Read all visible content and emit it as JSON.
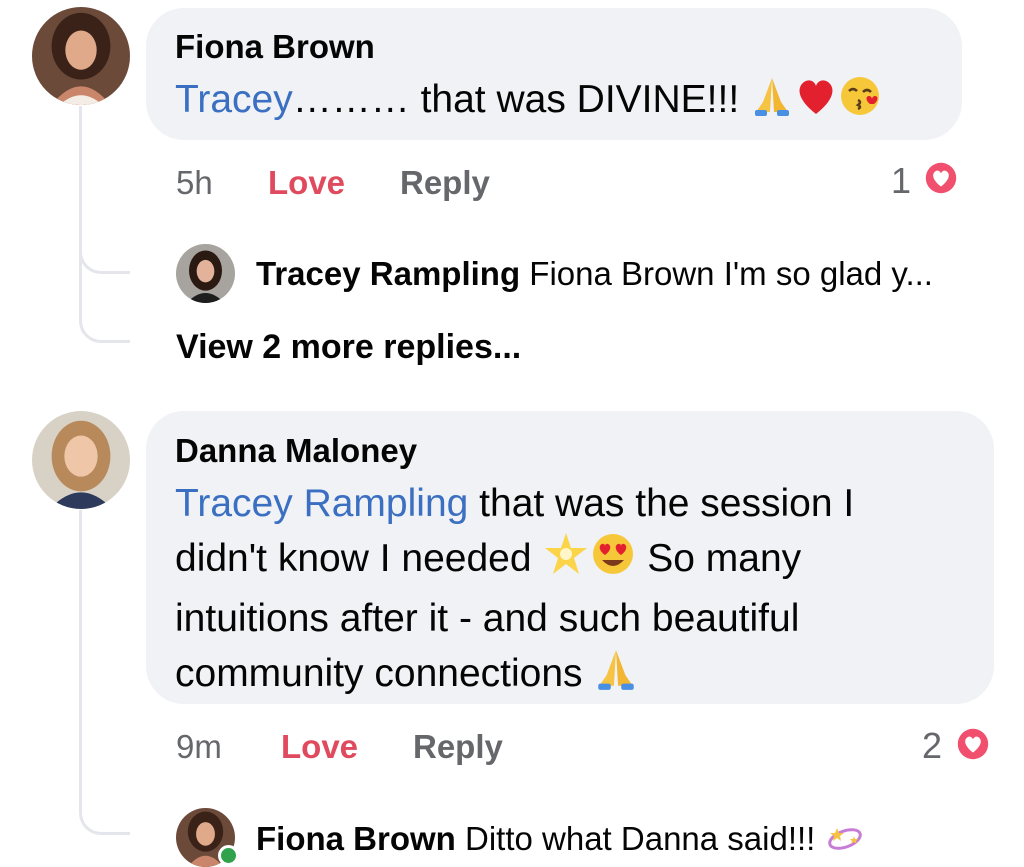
{
  "comments": [
    {
      "author": "Fiona Brown",
      "mention": "Tracey",
      "ellipsis": "………",
      "text": " that was DIVINE!!! ",
      "time": "5h",
      "love_label": "Love",
      "reply_label": "Reply",
      "reaction_count": "1",
      "emojis": [
        "folded-hands-emoji",
        "red-heart-emoji",
        "kissing-face-emoji"
      ],
      "reply": {
        "author": "Tracey Rampling",
        "text": "Fiona Brown I'm so glad y..."
      },
      "view_more": "View 2 more replies..."
    },
    {
      "author": "Danna Maloney",
      "mention": "Tracey Rampling",
      "line1_rest": " that was the session I",
      "line2_pre": "didn't know I needed ",
      "line2_post": " So many",
      "line3": "intuitions after it - and such beautiful",
      "line4": "community connections ",
      "time": "9m",
      "love_label": "Love",
      "reply_label": "Reply",
      "reaction_count": "2",
      "emojis": [
        "glowing-star-emoji",
        "heart-eyes-emoji",
        "folded-hands-emoji"
      ],
      "reply": {
        "author": "Fiona Brown",
        "text": "Ditto what Danna said!!! "
      }
    }
  ],
  "colors": {
    "bubble": "#f0f2f5",
    "mention": "#3a6fc2",
    "love": "#e04a5e",
    "muted": "#65676b",
    "online": "#31a24c"
  }
}
